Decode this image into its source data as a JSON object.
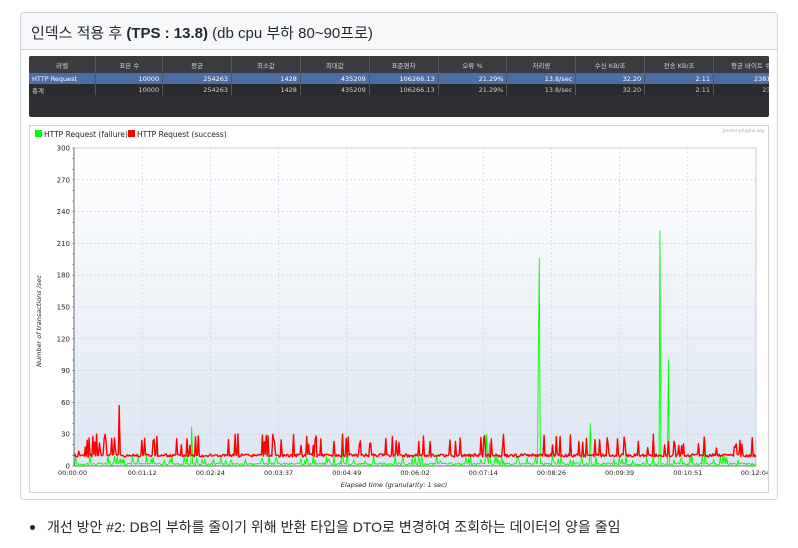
{
  "section": {
    "title_prefix": "인덱스 적용 후 ",
    "title_bold": "(TPS : 13.8)",
    "title_suffix": "  (db cpu 부하  80~90프로)"
  },
  "table": {
    "headers": [
      "라벨",
      "표본 수",
      "평균",
      "최소값",
      "최대값",
      "표준편차",
      "오류 %",
      "처리량",
      "수신 KB/초",
      "전송 KB/초",
      "평균 바이트 수"
    ],
    "rows": [
      [
        "HTTP Request",
        "10000",
        "254263",
        "1428",
        "435209",
        "106266.13",
        "21.29%",
        "13.8/sec",
        "32.20",
        "2.11",
        "2381.273"
      ],
      [
        "총계",
        "10000",
        "254263",
        "1428",
        "435209",
        "106266.13",
        "21.29%",
        "13.8/sec",
        "32.20",
        "2.11",
        "2381.3"
      ]
    ]
  },
  "chart_data": {
    "type": "line",
    "watermark": "jmeter-plugins.org",
    "legend": [
      {
        "name": "HTTP Request (failure)",
        "color": "#00ff00"
      },
      {
        "name": "HTTP Request (success)",
        "color": "#ff0000"
      }
    ],
    "legend_position": "top-left",
    "xlabel": "Elapsed time (granularity: 1 sec)",
    "ylabel": "Number of transactions /sec",
    "ylim": [
      0,
      300
    ],
    "y_ticks": [
      "0",
      "30",
      "60",
      "90",
      "120",
      "150",
      "180",
      "210",
      "240",
      "270",
      "300"
    ],
    "xlim_seconds": [
      0,
      724
    ],
    "x_ticks": [
      "00:00:00",
      "00:01:12",
      "00:02:24",
      "00:03:37",
      "00:04:49",
      "00:06:02",
      "00:07:14",
      "00:08:26",
      "00:09:39",
      "00:10:51",
      "00:12:04"
    ],
    "grid": true,
    "series": [
      {
        "name": "HTTP Request (failure)",
        "color": "#00ff00",
        "baseline": 2,
        "points": [
          [
            0,
            0
          ],
          [
            38,
            5
          ],
          [
            40,
            0
          ],
          [
            125,
            37
          ],
          [
            127,
            2
          ],
          [
            285,
            20
          ],
          [
            290,
            18
          ],
          [
            438,
            30
          ],
          [
            441,
            22
          ],
          [
            443,
            2
          ],
          [
            493,
            113
          ],
          [
            494,
            196
          ],
          [
            496,
            2
          ],
          [
            548,
            40
          ],
          [
            550,
            2
          ],
          [
            622,
            222
          ],
          [
            624,
            2
          ],
          [
            631,
            100
          ],
          [
            633,
            2
          ],
          [
            670,
            25
          ],
          [
            672,
            2
          ],
          [
            724,
            2
          ]
        ]
      },
      {
        "name": "HTTP Request (success)",
        "color": "#ff0000",
        "baseline": 10,
        "points": [
          [
            0,
            10
          ],
          [
            5,
            14
          ],
          [
            8,
            10
          ],
          [
            12,
            18
          ],
          [
            15,
            8
          ],
          [
            20,
            28
          ],
          [
            24,
            30
          ],
          [
            28,
            14
          ],
          [
            33,
            30
          ],
          [
            36,
            10
          ],
          [
            40,
            26
          ],
          [
            44,
            16
          ],
          [
            48,
            57
          ],
          [
            52,
            10
          ],
          [
            724,
            10
          ]
        ]
      }
    ]
  },
  "bullet": {
    "text": "개선 방안 #2: DB의 부하를 줄이기 위해 반환 타입을 DTO로 변경하여 조회하는 데이터의 양을 줄임"
  }
}
